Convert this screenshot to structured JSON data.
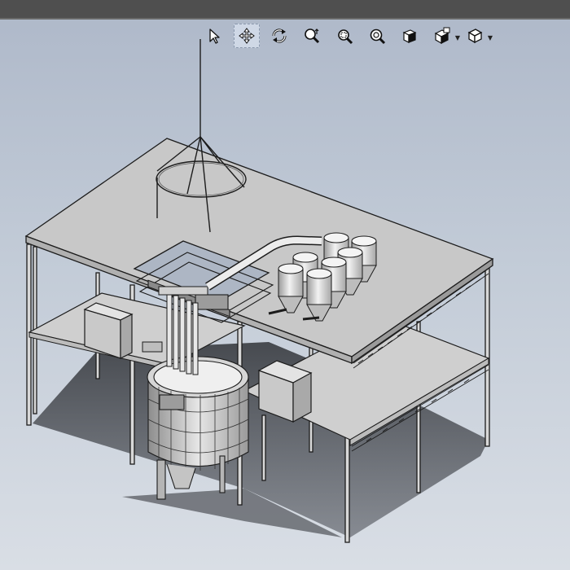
{
  "window": {
    "bar_color": "#4f4f4f",
    "background_top": "#aeb8c9",
    "background_bottom": "#d9dee5"
  },
  "view_toolbar": {
    "tools": [
      {
        "icon": "select-arrow-icon",
        "active": false
      },
      {
        "icon": "pan-icon",
        "active": true
      },
      {
        "icon": "rotate-view-icon",
        "active": false
      },
      {
        "icon": "zoom-in-out-icon",
        "active": false
      },
      {
        "icon": "zoom-to-area-icon",
        "active": false
      },
      {
        "icon": "zoom-to-fit-icon",
        "active": false
      },
      {
        "icon": "view-orientation-icon",
        "active": false
      },
      {
        "icon": "display-style-icon",
        "active": false,
        "dropdown": true
      },
      {
        "icon": "view-cube-icon",
        "active": false,
        "dropdown": true
      }
    ]
  },
  "model": {
    "description_visible": false,
    "hopper_count": 7
  }
}
